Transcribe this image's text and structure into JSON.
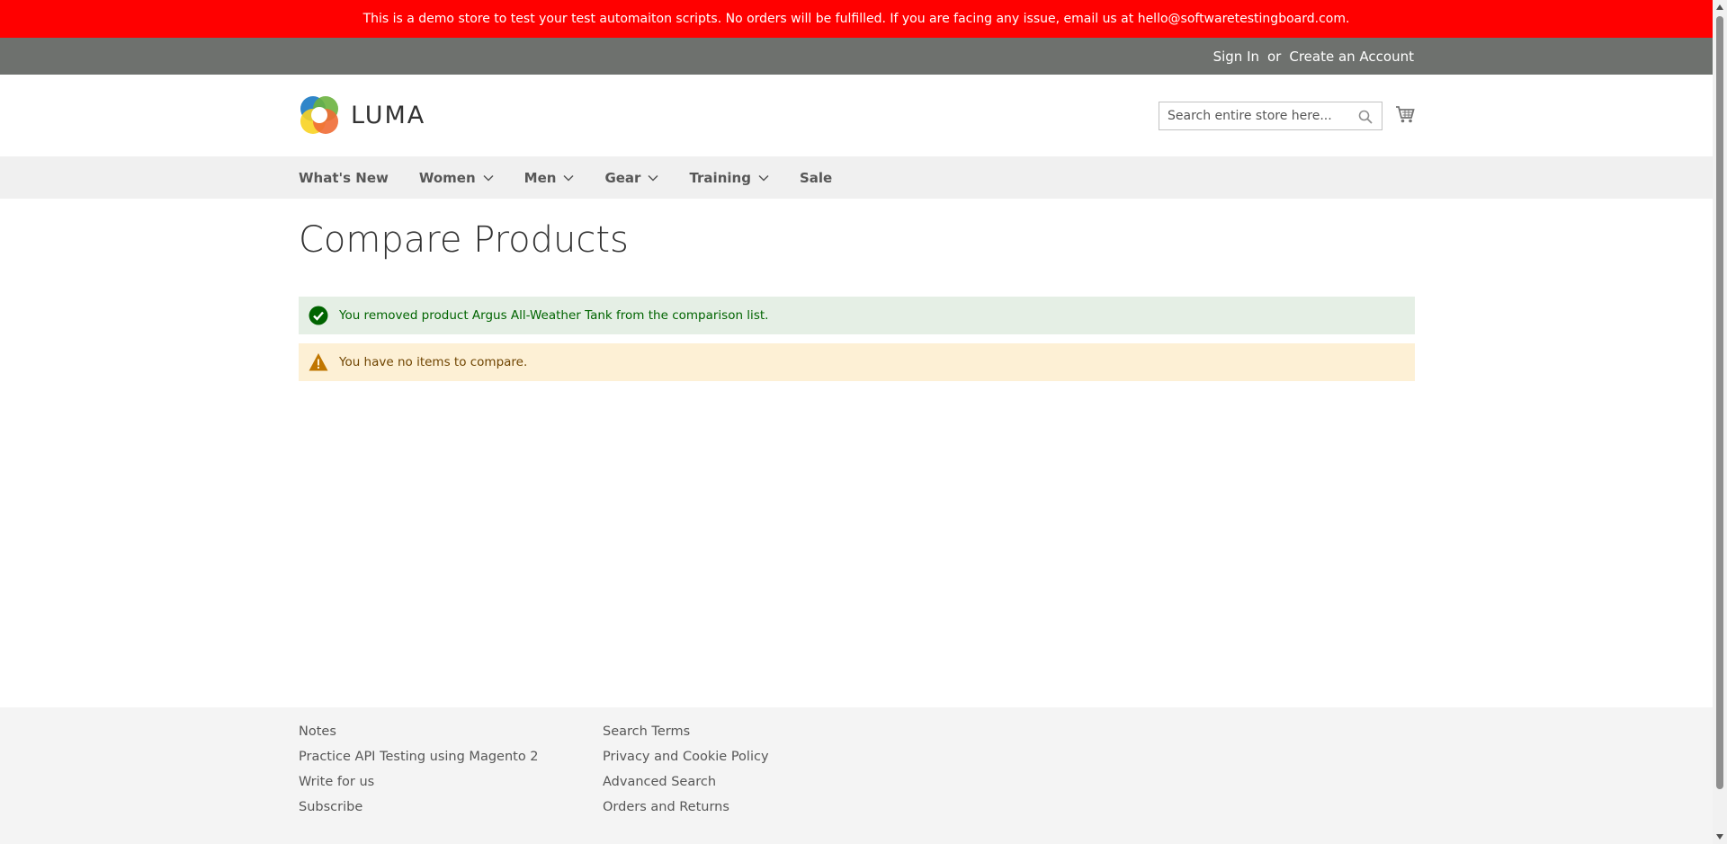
{
  "demo_banner": {
    "text": "This is a demo store to test your test automaiton scripts. No orders will be fulfilled. If you are facing any issue, email us at hello@softwaretestingboard.com."
  },
  "header_links": {
    "sign_in": "Sign In",
    "or": "or",
    "create_account": "Create an Account"
  },
  "logo": {
    "text": "LUMA"
  },
  "search": {
    "placeholder": "Search entire store here..."
  },
  "nav": {
    "items": [
      {
        "label": "What's New",
        "dropdown": false
      },
      {
        "label": "Women",
        "dropdown": true
      },
      {
        "label": "Men",
        "dropdown": true
      },
      {
        "label": "Gear",
        "dropdown": true
      },
      {
        "label": "Training",
        "dropdown": true
      },
      {
        "label": "Sale",
        "dropdown": false
      }
    ]
  },
  "page": {
    "title": "Compare Products"
  },
  "messages": {
    "success": "You removed product Argus All-Weather Tank from the comparison list.",
    "warning": "You have no items to compare."
  },
  "footer": {
    "col1": [
      "Notes",
      "Practice API Testing using Magento 2",
      "Write for us",
      "Subscribe"
    ],
    "col2": [
      "Search Terms",
      "Privacy and Cookie Policy",
      "Advanced Search",
      "Orders and Returns"
    ]
  },
  "colors": {
    "banner": "#ff0000",
    "panel_header": "#6e716e",
    "success_bg": "#e5efe5",
    "success_text": "#006400",
    "warning_bg": "#fdf0d5",
    "warning_text": "#6f4400"
  },
  "icons": {
    "search": "search-icon",
    "cart": "cart-icon",
    "success": "check-circle-icon",
    "warning": "warning-triangle-icon",
    "chevron": "chevron-down-icon"
  }
}
